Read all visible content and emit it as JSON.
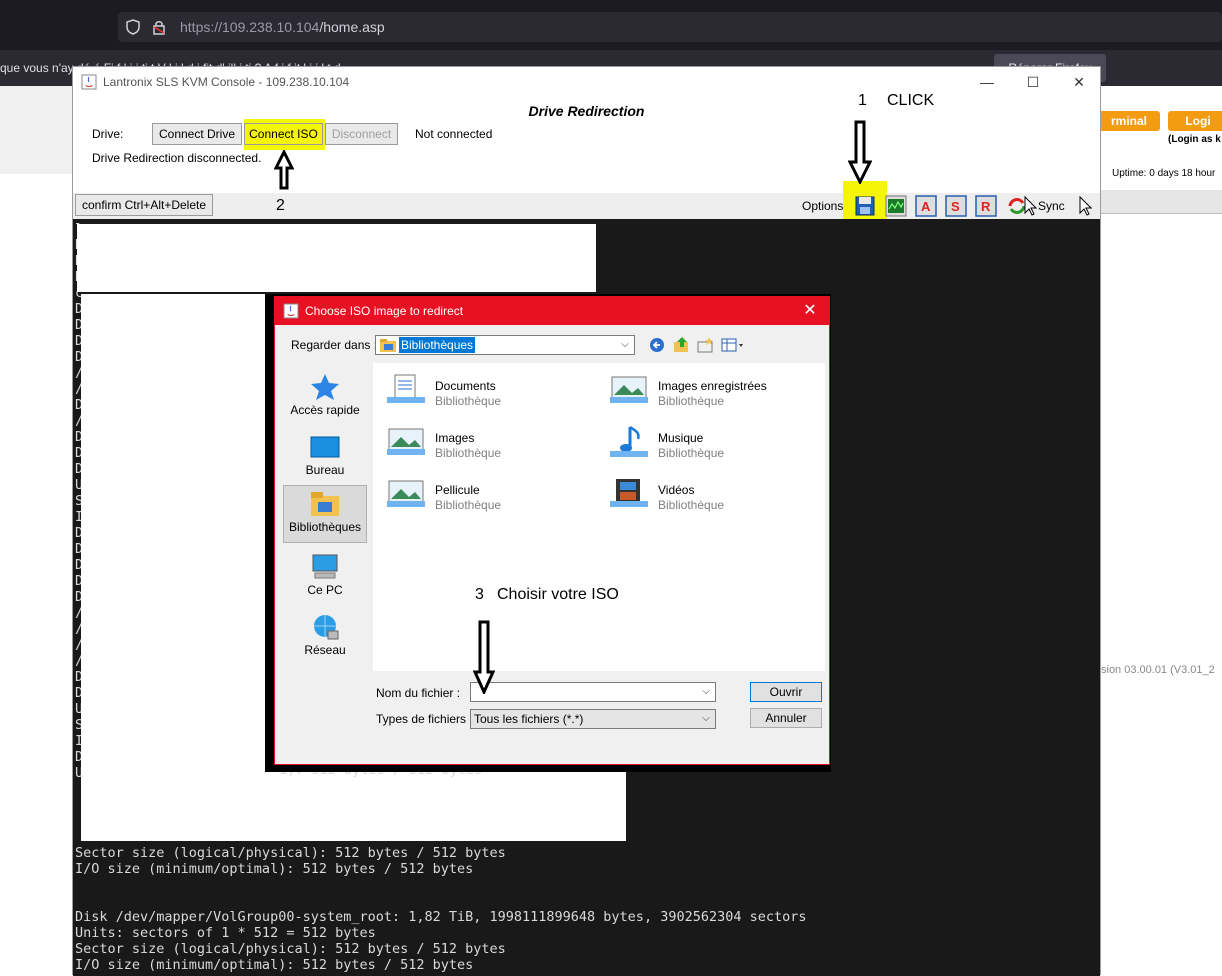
{
  "browser": {
    "url_host": "https://109.238.10.104",
    "url_path": "/home.asp",
    "notification_text": "que vous n'ay                    dé   é Fi   f   l    i      i     ti      t    V   l        i   l    d     i       fit     d'       ill      i ti     ? A  f i    f it l i   i l           t   d",
    "notification_button": "Réparer Firefox"
  },
  "page": {
    "terminal_btn": "rminal",
    "login_btn": "Logi",
    "login_note": "(Login as k",
    "uptime": "Uptime: 0 days 18 hour",
    "version": "sion 03.00.01 (V3.01_2"
  },
  "kvm": {
    "title": "Lantronix SLS KVM Console - 109.238.10.104",
    "minimize": "—",
    "maximize": "☐",
    "close": "✕",
    "heading": "Drive Redirection",
    "drive_label": "Drive:",
    "connect_drive": "Connect Drive",
    "connect_iso": "Connect ISO",
    "disconnect": "Disconnect",
    "status": "Not connected",
    "message": "Drive Redirection disconnected.",
    "confirm_cad": "confirm Ctrl+Alt+Delete",
    "options": "Options",
    "sync": "Sync"
  },
  "terminal": {
    "left_chars": [
      "l",
      "D",
      "D",
      "D",
      "c",
      "D",
      "D",
      "D",
      "D",
      "/",
      "/",
      "D",
      "/",
      "D",
      "D",
      "D",
      "U",
      "S",
      "I",
      "D",
      "D",
      "D",
      "D",
      "D",
      "/",
      "/",
      "/",
      "/",
      "D",
      "D",
      "U",
      "S",
      "I",
      "D",
      "U"
    ],
    "line1": "Sector size (logical/physical): 512 bytes / 512 bytes",
    "line2": "I/O size (minimum/optimal): 512 bytes / 512 bytes",
    "line3": "Disk /dev/mapper/VolGroup00-system_root: 1,82 TiB, 1998111899648 bytes, 3902562304 sectors",
    "line4": "Units: sectors of 1 * 512 = 512 bytes",
    "line5": "Sector size (logical/physical): 512 bytes / 512 bytes",
    "line6": "I/O size (minimum/optimal): 512 bytes / 512 bytes",
    "partial1": "1): 512 bytes / 512 bytes"
  },
  "annotations": {
    "step1": "1",
    "click": "CLICK",
    "step2": "2",
    "step3": "3",
    "step3_text": "Choisir votre ISO"
  },
  "dialog": {
    "title": "Choose ISO image to redirect",
    "close": "✕",
    "look_in_label": "Regarder dans :",
    "look_in_value": "Bibliothèques",
    "nav": [
      {
        "label": "Accès rapide",
        "icon": "star-icon"
      },
      {
        "label": "Bureau",
        "icon": "desktop-icon"
      },
      {
        "label": "Bibliothèques",
        "icon": "libraries-icon"
      },
      {
        "label": "Ce PC",
        "icon": "computer-icon"
      },
      {
        "label": "Réseau",
        "icon": "network-icon"
      }
    ],
    "items": [
      {
        "name": "Documents",
        "sub": "Bibliothèque",
        "icon": "documents-icon"
      },
      {
        "name": "Images enregistrées",
        "sub": "Bibliothèque",
        "icon": "saved-pictures-icon"
      },
      {
        "name": "Images",
        "sub": "Bibliothèque",
        "icon": "pictures-icon"
      },
      {
        "name": "Musique",
        "sub": "Bibliothèque",
        "icon": "music-icon"
      },
      {
        "name": "Pellicule",
        "sub": "Bibliothèque",
        "icon": "camera-roll-icon"
      },
      {
        "name": "Vidéos",
        "sub": "Bibliothèque",
        "icon": "videos-icon"
      }
    ],
    "filename_label": "Nom du fichier :",
    "filename_value": "",
    "filetype_label": "Types de fichiers :",
    "filetype_value": "Tous les fichiers (*.*)",
    "open_btn": "Ouvrir",
    "cancel_btn": "Annuler"
  },
  "colors": {
    "highlight": "#f5f50a",
    "dialog_accent": "#e81123",
    "terminal_bg": "#191919"
  }
}
